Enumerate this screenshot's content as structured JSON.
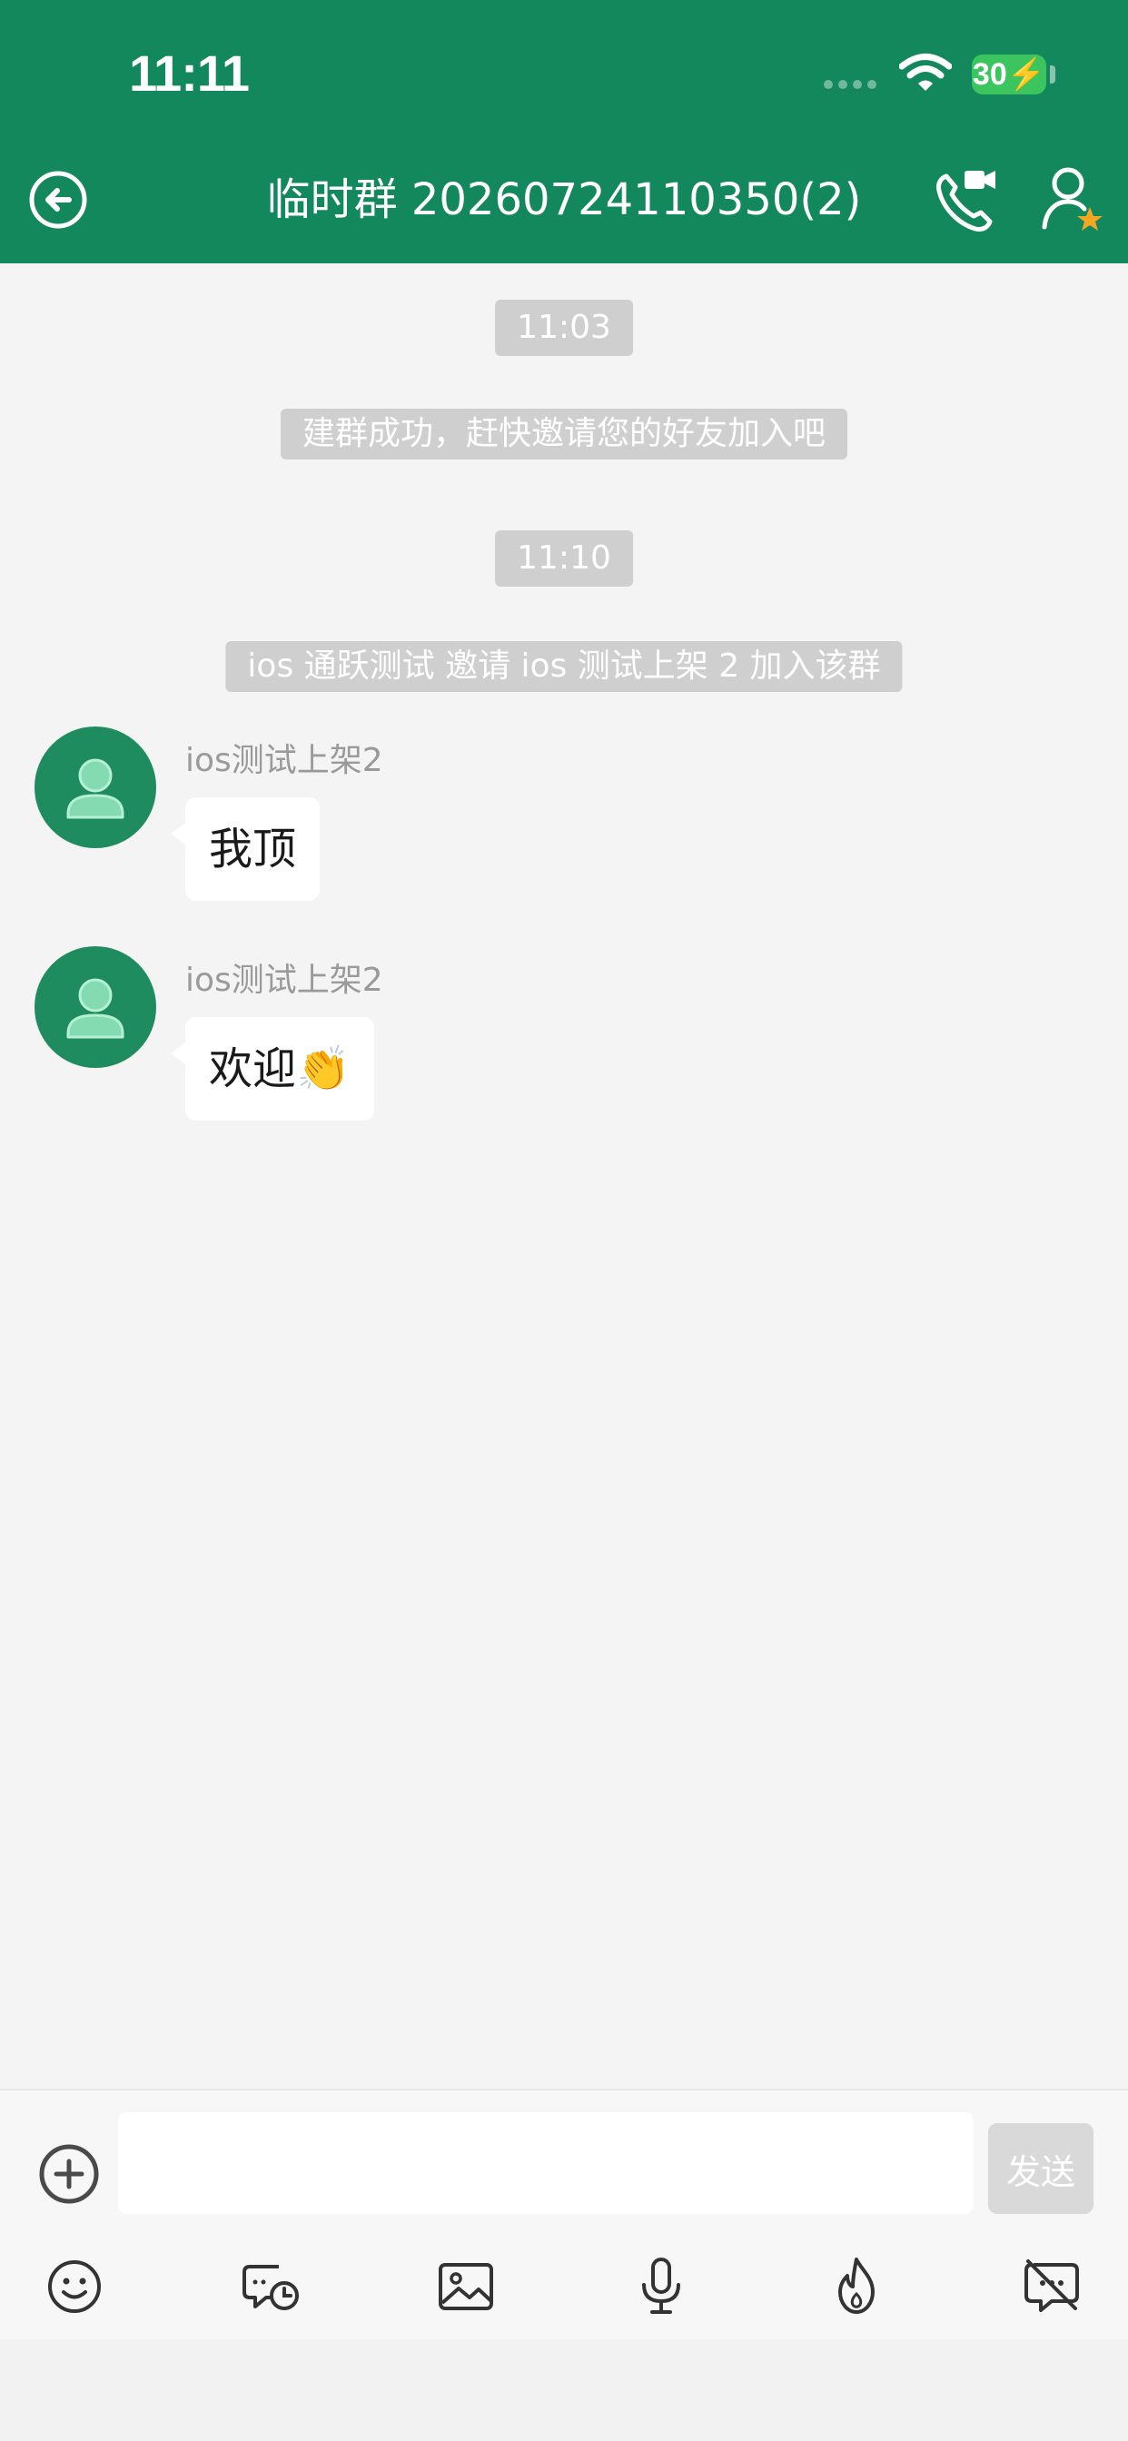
{
  "status_bar": {
    "time": "11:11",
    "battery": "30"
  },
  "header": {
    "title": "临时群 20260724110350(2)"
  },
  "messages": [
    {
      "time": "11:03"
    },
    {
      "system": "建群成功，赶快邀请您的好友加入吧"
    },
    {
      "time": "11:10"
    },
    {
      "system": "ios 通跃测试 邀请 ios 测试上架 2 加入该群"
    },
    {
      "sender": "ios测试上架2",
      "text": "我顶"
    },
    {
      "sender": "ios测试上架2",
      "text": "欢迎👏"
    }
  ],
  "input": {
    "placeholder": "",
    "send_label": "发送"
  },
  "toolbar": [
    "emoji-icon",
    "scheduled-message-icon",
    "image-icon",
    "microphone-icon",
    "burn-after-reading-icon",
    "hide-chat-icon"
  ],
  "colors": {
    "header": "#13885c",
    "background": "#f4f4f4",
    "avatar": "#1e8c5e",
    "system_pill": "#cfcfcf"
  }
}
